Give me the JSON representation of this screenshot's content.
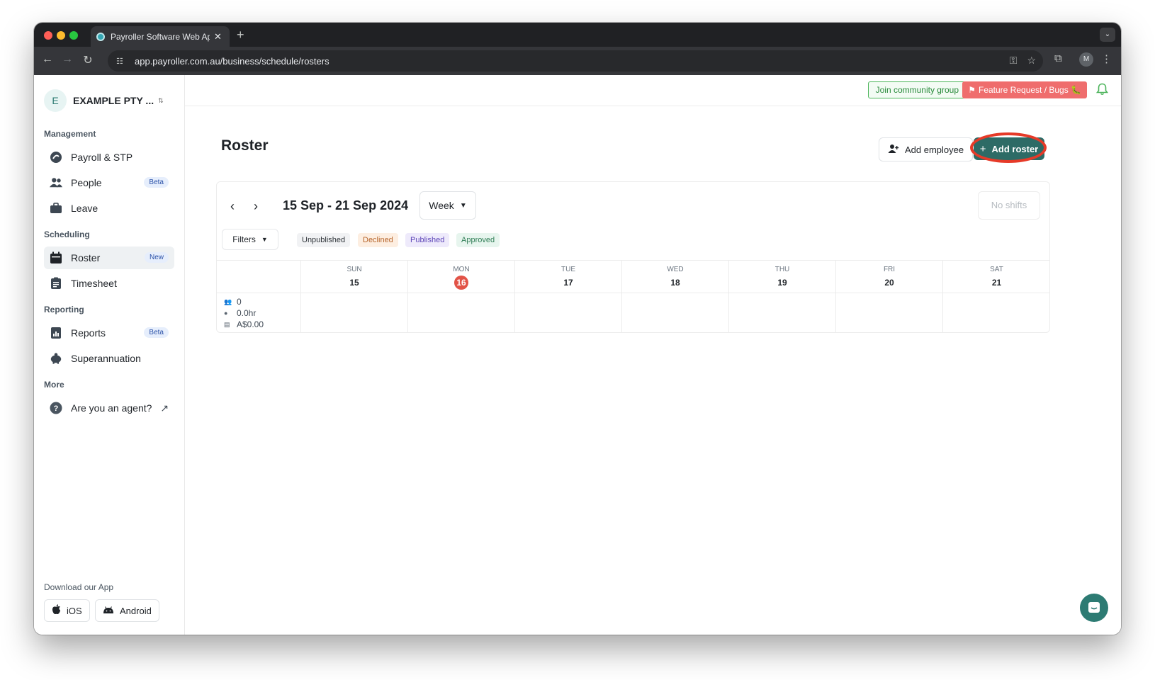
{
  "browser": {
    "tab_title": "Payroller Software Web Applic",
    "tab_close": "✕",
    "new_tab": "+",
    "url": "app.payroller.com.au/business/schedule/rosters",
    "profile_initial": "M"
  },
  "sidebar": {
    "org_initial": "E",
    "org_name": "EXAMPLE PTY ...",
    "sections": {
      "management": "Management",
      "scheduling": "Scheduling",
      "reporting": "Reporting",
      "more": "More"
    },
    "items": [
      {
        "label": "Payroll & STP"
      },
      {
        "label": "People",
        "badge": "Beta"
      },
      {
        "label": "Leave"
      },
      {
        "label": "Roster",
        "badge": "New"
      },
      {
        "label": "Timesheet"
      },
      {
        "label": "Reports",
        "badge": "Beta"
      },
      {
        "label": "Superannuation"
      },
      {
        "label": "Are you an agent?"
      }
    ],
    "download_label": "Download our App",
    "ios_label": "iOS",
    "android_label": "Android"
  },
  "header": {
    "community_label": "Join community group",
    "feature_label": "Feature Request / Bugs 🐛"
  },
  "main": {
    "title": "Roster",
    "add_employee_label": "Add employee",
    "add_roster_label": "Add roster",
    "date_range": "15 Sep - 21 Sep 2024",
    "view_select": "Week",
    "no_shifts_label": "No shifts",
    "filters_label": "Filters",
    "statuses": [
      {
        "label": "Unpublished",
        "bg": "#f1f2f4",
        "fg": "#2f3439"
      },
      {
        "label": "Declined",
        "bg": "#fdeee1",
        "fg": "#b7652b"
      },
      {
        "label": "Published",
        "bg": "#eeeafb",
        "fg": "#5e46b8"
      },
      {
        "label": "Approved",
        "bg": "#e7f5ee",
        "fg": "#2f7d55"
      }
    ],
    "days": [
      {
        "name": "SUN",
        "num": "15"
      },
      {
        "name": "MON",
        "num": "16",
        "today": true
      },
      {
        "name": "TUE",
        "num": "17"
      },
      {
        "name": "WED",
        "num": "18"
      },
      {
        "name": "THU",
        "num": "19"
      },
      {
        "name": "FRI",
        "num": "20"
      },
      {
        "name": "SAT",
        "num": "21"
      }
    ],
    "stats": {
      "people": "0",
      "hours": "0.0hr",
      "cost": "A$0.00"
    }
  },
  "colors": {
    "brand": "#2d6b66",
    "highlight_ring": "#e63a28",
    "today": "#e25347"
  }
}
